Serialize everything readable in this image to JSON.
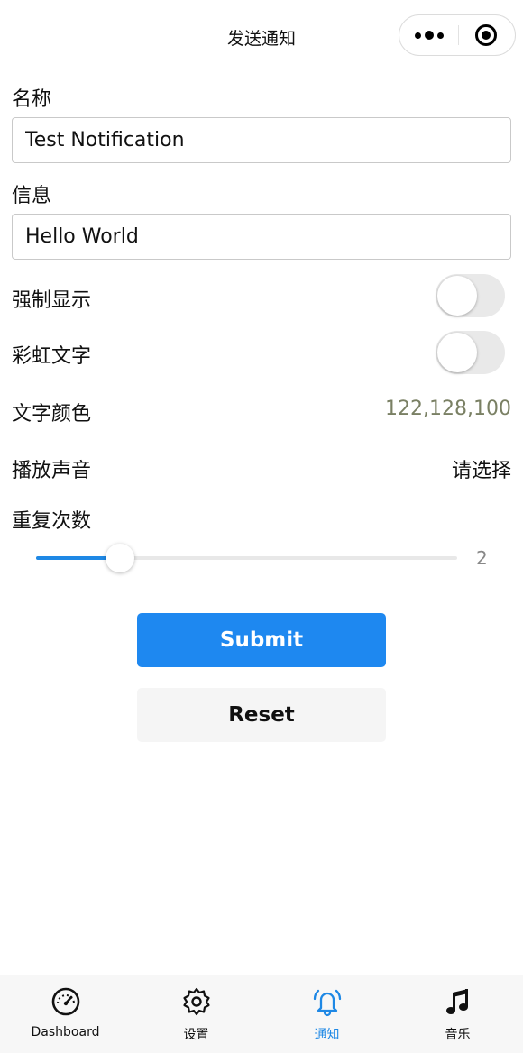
{
  "nav": {
    "title": "发送通知"
  },
  "form": {
    "name": {
      "label": "名称",
      "value": "Test Notification"
    },
    "message": {
      "label": "信息",
      "value": "Hello World"
    },
    "force_show": {
      "label": "强制显示",
      "checked": false
    },
    "rainbow_text": {
      "label": "彩虹文字",
      "checked": false
    },
    "text_color": {
      "label": "文字颜色",
      "value": "122,128,100",
      "color": "#7a8064"
    },
    "play_sound": {
      "label": "播放声音",
      "value": "请选择"
    },
    "repeat_count": {
      "label": "重复次数",
      "value": "2",
      "fraction": 0.2
    }
  },
  "buttons": {
    "submit": "Submit",
    "reset": "Reset"
  },
  "tabs": [
    {
      "label": "Dashboard",
      "icon": "speedometer-icon",
      "active": false
    },
    {
      "label": "设置",
      "icon": "gear-icon",
      "active": false
    },
    {
      "label": "通知",
      "icon": "bell-icon",
      "active": true
    },
    {
      "label": "音乐",
      "icon": "music-note-icon",
      "active": false
    }
  ],
  "colors": {
    "accent": "#1e88e5",
    "submit_bg": "#1e88f0",
    "reset_bg": "#f5f5f5",
    "toggle_off": "#e9e9e9"
  }
}
